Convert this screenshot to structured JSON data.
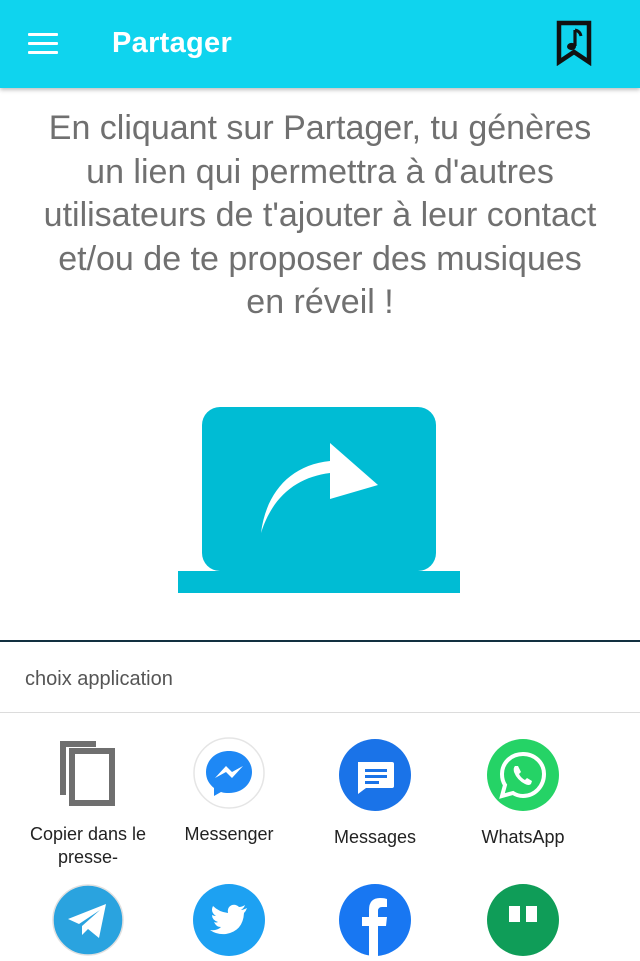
{
  "appbar": {
    "title": "Partager",
    "background": "#0fd4ee",
    "menu_icon": "hamburger-menu-icon",
    "action_icon": "music-bookmark-icon"
  },
  "intro": {
    "text": "En cliquant sur Partager, tu génères un lien qui permettra à d'autres utilisateurs de t'ajouter à leur contact et/ou de te proposer des musiques en réveil !"
  },
  "illustration": {
    "icon": "share-arrow-laptop-icon",
    "color": "#00bcd4"
  },
  "share_sheet": {
    "title": "choix application",
    "apps": [
      {
        "label": "Copier dans le presse-",
        "icon": "copy-icon"
      },
      {
        "label": "Messenger",
        "icon": "messenger-icon",
        "color": "#1e88f5"
      },
      {
        "label": "Messages",
        "icon": "messages-icon",
        "color": "#1a73e8"
      },
      {
        "label": "WhatsApp",
        "icon": "whatsapp-icon",
        "color": "#25d366"
      },
      {
        "label": "",
        "icon": "telegram-icon",
        "color": "#2aa3df"
      },
      {
        "label": "",
        "icon": "twitter-icon",
        "color": "#1da1f2"
      },
      {
        "label": "",
        "icon": "facebook-icon",
        "color": "#1877f2"
      },
      {
        "label": "",
        "icon": "hangouts-icon",
        "color": "#0f9d58"
      }
    ]
  }
}
